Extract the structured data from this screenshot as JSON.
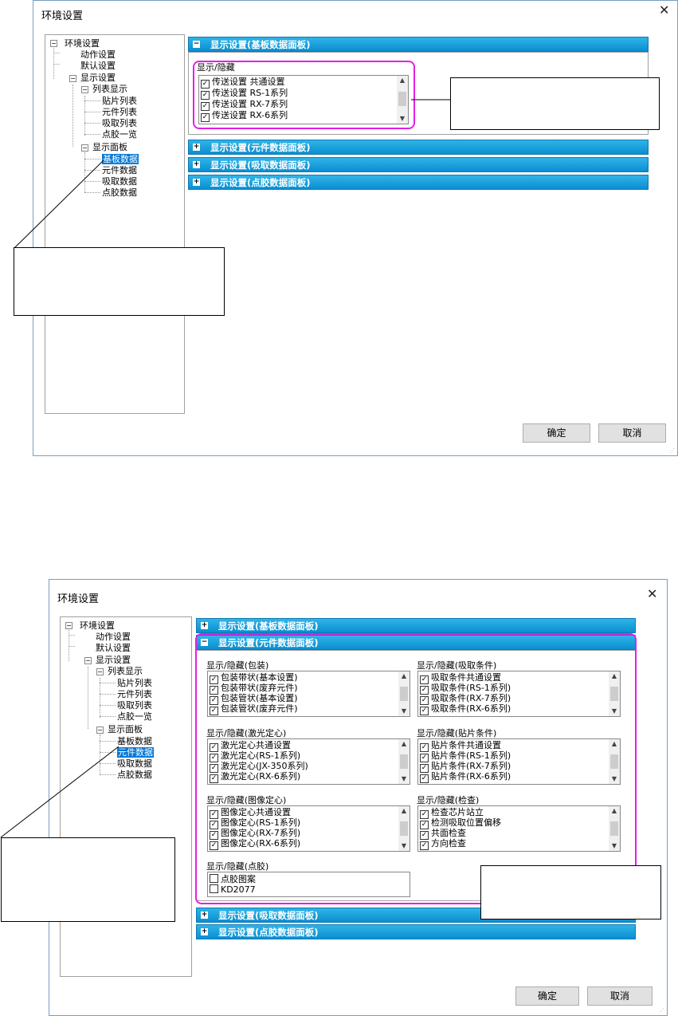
{
  "dialog1": {
    "title": "环境设置",
    "close_glyph": "✕",
    "tree": {
      "root": "环境设置",
      "action": "动作设置",
      "default": "默认设置",
      "display": "显示设置",
      "list_display": "列表显示",
      "placement_list": "贴片列表",
      "component_list": "元件列表",
      "pickup_list": "吸取列表",
      "dispense_list": "点胶一览",
      "display_panel": "显示面板",
      "board_data": "基板数据",
      "component_data": "元件数据",
      "pickup_data": "吸取数据",
      "dispense_data": "点胶数据"
    },
    "sections": [
      {
        "label": "显示设置(基板数据面板)",
        "toggle": "−"
      },
      {
        "label": "显示设置(元件数据面板)",
        "toggle": "+"
      },
      {
        "label": "显示设置(吸取数据面板)",
        "toggle": "+"
      },
      {
        "label": "显示设置(点胶数据面板)",
        "toggle": "+"
      }
    ],
    "group_label": "显示/隐藏",
    "items": [
      "传送设置 共通设置",
      "传送设置 RS-1系列",
      "传送设置 RX-7系列",
      "传送设置 RX-6系列"
    ],
    "ok": "确定",
    "cancel": "取消"
  },
  "dialog2": {
    "title": "环境设置",
    "close_glyph": "✕",
    "tree": {
      "root": "环境设置",
      "action": "动作设置",
      "default": "默认设置",
      "display": "显示设置",
      "list_display": "列表显示",
      "placement_list": "贴片列表",
      "component_list": "元件列表",
      "pickup_list": "吸取列表",
      "dispense_list": "点胶一览",
      "display_panel": "显示面板",
      "board_data": "基板数据",
      "component_data": "元件数据",
      "pickup_data": "吸取数据",
      "dispense_data": "点胶数据"
    },
    "sections": [
      {
        "label": "显示设置(基板数据面板)",
        "toggle": "+"
      },
      {
        "label": "显示设置(元件数据面板)",
        "toggle": "−"
      },
      {
        "label": "显示设置(吸取数据面板)",
        "toggle": "+"
      },
      {
        "label": "显示设置(点胶数据面板)",
        "toggle": "+"
      }
    ],
    "groups": {
      "packaging": {
        "label": "显示/隐藏(包装)",
        "items": [
          "包装带状(基本设置)",
          "包装带状(废弃元件)",
          "包装管状(基本设置)",
          "包装管状(废弃元件)"
        ]
      },
      "pickup": {
        "label": "显示/隐藏(吸取条件)",
        "items": [
          "吸取条件共通设置",
          "吸取条件(RS-1系列)",
          "吸取条件(RX-7系列)",
          "吸取条件(RX-6系列)"
        ]
      },
      "laser": {
        "label": "显示/隐藏(激光定心)",
        "items": [
          "激光定心共通设置",
          "激光定心(RS-1系列)",
          "激光定心(JX-350系列)",
          "激光定心(RX-6系列)"
        ]
      },
      "placement": {
        "label": "显示/隐藏(贴片条件)",
        "items": [
          "贴片条件共通设置",
          "贴片条件(RS-1系列)",
          "贴片条件(RX-7系列)",
          "贴片条件(RX-6系列)"
        ]
      },
      "vision": {
        "label": "显示/隐藏(图像定心)",
        "items": [
          "图像定心共通设置",
          "图像定心(RS-1系列)",
          "图像定心(RX-7系列)",
          "图像定心(RX-6系列)"
        ]
      },
      "inspection": {
        "label": "显示/隐藏(检查)",
        "items": [
          "检查芯片站立",
          "检测吸取位置偏移",
          "共面检查",
          "方向检查"
        ]
      },
      "dispense": {
        "label": "显示/隐藏(点胶)",
        "items": [
          "点胶图案",
          "KD2077"
        ]
      }
    },
    "ok": "确定",
    "cancel": "取消"
  },
  "glyphs": {
    "check": "✓",
    "up": "▲",
    "down": "▼",
    "grip": "⋰"
  },
  "colors": {
    "highlight": "#e61ee6",
    "header": "#1aa3e0",
    "selection": "#0078d7"
  }
}
